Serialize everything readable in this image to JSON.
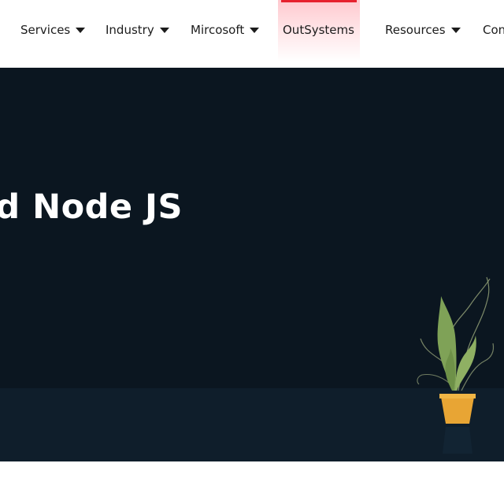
{
  "nav": {
    "items": [
      {
        "label": "Services",
        "has_dropdown": true
      },
      {
        "label": "Industry",
        "has_dropdown": true
      },
      {
        "label": "Mircosoft",
        "has_dropdown": true
      },
      {
        "label": "OutSystems",
        "has_dropdown": false,
        "active": true
      },
      {
        "label": "Resources",
        "has_dropdown": true
      },
      {
        "label": "Con",
        "has_dropdown": false
      }
    ],
    "active_color": "#e6212e",
    "caret_icon": "caret-down-icon"
  },
  "hero": {
    "title": "d Node JS",
    "background_color": "#0b1620",
    "floor_color": "#0f1e2b",
    "illustration": "potted-plant-icon",
    "pot_color": "#e8a534",
    "leaf_color": "#7fa257"
  }
}
